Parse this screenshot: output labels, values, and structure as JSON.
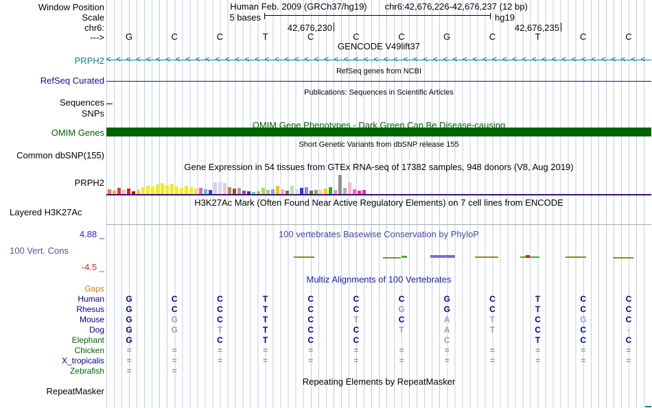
{
  "colors": {
    "gencode_teal": "#0d7d92",
    "refseq_blue": "#10108c",
    "omim_green": "#006400",
    "gtex_baseline": "#3c0a78",
    "phylop_title": "#4646aa",
    "phylop_max": "#2828cc",
    "phylop_min": "#c03030",
    "phylop_label": "#55509b",
    "multiz_title": "#1a1aae",
    "species_blue": "#00008b",
    "species_green": "#006400",
    "gaps_orange": "#c8820a",
    "grid_line": "#bfcdec",
    "h3k27ac_base": "#a6a6a6"
  },
  "header": {
    "window_position_label": "Window Position",
    "assembly": "Human Feb. 2009 (GRCh37/hg19)",
    "range": "chr6:42,676,226-42,676,237 (12 bp)",
    "scale_label": "Scale",
    "scale_text": "5 bases",
    "genome": "hg19",
    "chrom": "chr6:",
    "tick_left": "42,676,230",
    "tick_right": "42,676,235",
    "strand": "--->"
  },
  "sequence": [
    "G",
    "C",
    "C",
    "T",
    "C",
    "C",
    "C",
    "G",
    "C",
    "T",
    "C",
    "C"
  ],
  "gencode": {
    "title": "GENCODE V49lift37",
    "gene": "PRPH2",
    "arrow": "<"
  },
  "refseq": {
    "title": "RefSeq genes from NCBI",
    "label": "RefSeq Curated"
  },
  "publications": {
    "title": "Publications: Sequences in Scientific Articles",
    "label": "Sequences"
  },
  "snps_label": "SNPs",
  "omim": {
    "title": "OMIM Gene Phenotypes - Dark Green Can Be Disease-causing",
    "label": "OMIM Genes"
  },
  "dbsnp": {
    "title": "Short Genetic Variants from dbSNP release 155",
    "label": "Common dbSNP(155)"
  },
  "gtex": {
    "title": "Gene Expression in 54 tissues from GTEx RNA-seq of 17382 samples, 948 donors (V8, Aug 2019)",
    "label": "PRPH2",
    "bars": [
      [
        7,
        "#ff7733"
      ],
      [
        5,
        "#ffaa55"
      ],
      [
        9,
        "#ee3333"
      ],
      [
        6,
        "#ffbbaa"
      ],
      [
        8,
        "#cc2222"
      ],
      [
        4,
        "#991111"
      ],
      [
        6,
        "#eecc44"
      ],
      [
        10,
        "#eeee22"
      ],
      [
        12,
        "#eeee22"
      ],
      [
        11,
        "#eeee22"
      ],
      [
        14,
        "#eeee22"
      ],
      [
        16,
        "#eeee22"
      ],
      [
        13,
        "#eeee22"
      ],
      [
        15,
        "#eeee22"
      ],
      [
        11,
        "#eeee22"
      ],
      [
        9,
        "#eeee22"
      ],
      [
        12,
        "#eeee22"
      ],
      [
        10,
        "#eeee22"
      ],
      [
        8,
        "#eeee22"
      ],
      [
        9,
        "#ff55cc"
      ],
      [
        7,
        "#44cccc"
      ],
      [
        6,
        "#3344ee"
      ],
      [
        17,
        "#e0c8ee"
      ],
      [
        18,
        "#d8d8e8"
      ],
      [
        16,
        "#f0c8d8"
      ],
      [
        10,
        "#bb8855"
      ],
      [
        8,
        "#885533"
      ],
      [
        9,
        "#cc9977"
      ],
      [
        5,
        "#8844cc"
      ],
      [
        4,
        "#662299"
      ],
      [
        3,
        "#33ddcc"
      ],
      [
        4,
        "#aabb66"
      ],
      [
        9,
        "#99ee22"
      ],
      [
        6,
        "#a8c898"
      ],
      [
        7,
        "#9a9aee"
      ],
      [
        12,
        "#eec800"
      ],
      [
        7,
        "#ffaadd"
      ],
      [
        5,
        "#996633"
      ],
      [
        12,
        "#aaeea0"
      ],
      [
        7,
        "#dddddd"
      ],
      [
        9,
        "#3333ee"
      ],
      [
        10,
        "#8888ff"
      ],
      [
        5,
        "#667722"
      ],
      [
        6,
        "#88aa66"
      ],
      [
        6,
        "#ffdd88"
      ],
      [
        8,
        "#ffcc00"
      ],
      [
        10,
        "#22aa44"
      ],
      [
        6,
        "#ff88cc"
      ],
      [
        28,
        "#909090"
      ],
      [
        9,
        "#b0b0b0"
      ],
      [
        17,
        "#ffb6c8"
      ],
      [
        7,
        "#ff66bb"
      ],
      [
        5,
        "#ff22aa"
      ],
      [
        6,
        "#cc4488"
      ]
    ]
  },
  "h3k27ac": {
    "title": "H3K27Ac Mark (Often Found Near Active Regulatory Elements) on 7 cell lines from ENCODE",
    "label": "Layered H3K27Ac"
  },
  "phylop": {
    "title": "100 vertebrates Basewise Conservation by PhyloP",
    "label": "100 Vert. Cons",
    "max": "4.88 _",
    "min": "-4.5 _",
    "marks": [
      [
        428,
        374,
        30,
        2,
        "#8b8b1a"
      ],
      [
        558,
        375,
        26,
        2,
        "#8b8b1a"
      ],
      [
        585,
        373,
        8,
        3,
        "#44aa22"
      ],
      [
        627,
        372,
        36,
        4,
        "#7a6ad8"
      ],
      [
        692,
        374,
        34,
        2,
        "#8b8b1a"
      ],
      [
        758,
        374,
        28,
        2,
        "#44aa22"
      ],
      [
        766,
        372,
        6,
        4,
        "#cc2222"
      ],
      [
        824,
        374,
        30,
        2,
        "#8b8b1a"
      ],
      [
        893,
        375,
        30,
        2,
        "#8b8b1a"
      ]
    ]
  },
  "multiz": {
    "title": "Multiz Alignments of 100 Vertebrates",
    "rows": [
      {
        "name": "Gaps",
        "color": "#c8820a",
        "cells": []
      },
      {
        "name": "Human",
        "color": "#00008b",
        "cells": [
          [
            "G",
            "b"
          ],
          [
            "C",
            "b"
          ],
          [
            "C",
            "b"
          ],
          [
            "T",
            "b"
          ],
          [
            "C",
            "b"
          ],
          [
            "C",
            "b"
          ],
          [
            "C",
            "b"
          ],
          [
            "G",
            "b"
          ],
          [
            "C",
            "b"
          ],
          [
            "T",
            "b"
          ],
          [
            "C",
            "b"
          ],
          [
            "C",
            "b"
          ]
        ]
      },
      {
        "name": "Rhesus",
        "color": "#00008b",
        "cells": [
          [
            "G",
            "b"
          ],
          [
            "C",
            "b"
          ],
          [
            "C",
            "b"
          ],
          [
            "T",
            "b"
          ],
          [
            "C",
            "b"
          ],
          [
            "C",
            "b"
          ],
          [
            "G",
            "g"
          ],
          [
            "G",
            "b"
          ],
          [
            "C",
            "b"
          ],
          [
            "T",
            "b"
          ],
          [
            "C",
            "b"
          ],
          [
            "C",
            "b"
          ]
        ]
      },
      {
        "name": "Mouse",
        "color": "#00008b",
        "cells": [
          [
            "G",
            "b"
          ],
          [
            "G",
            "g"
          ],
          [
            "C",
            "b"
          ],
          [
            "T",
            "b"
          ],
          [
            "C",
            "b"
          ],
          [
            "T",
            "g"
          ],
          [
            "C",
            "b"
          ],
          [
            "A",
            "g"
          ],
          [
            "T",
            "g"
          ],
          [
            "C",
            "b"
          ],
          [
            "G",
            "g"
          ],
          [
            "C",
            "b"
          ]
        ]
      },
      {
        "name": "Dog",
        "color": "#00008b",
        "cells": [
          [
            "G",
            "b"
          ],
          [
            "G",
            "g"
          ],
          [
            "T",
            "g"
          ],
          [
            "T",
            "b"
          ],
          [
            "C",
            "b"
          ],
          [
            "C",
            "b"
          ],
          [
            "T",
            "g"
          ],
          [
            "A",
            "g"
          ],
          [
            "T",
            "g"
          ],
          [
            "C",
            "b"
          ],
          [
            "C",
            "b"
          ],
          [
            "-",
            "g"
          ]
        ]
      },
      {
        "name": "Elephant",
        "color": "#006400",
        "cells": [
          [
            "G",
            "b"
          ],
          [
            "",
            "b"
          ],
          [
            "C",
            "b"
          ],
          [
            "T",
            "b"
          ],
          [
            "C",
            "b"
          ],
          [
            "C",
            "b"
          ],
          [
            "",
            "b"
          ],
          [
            "C",
            "g"
          ],
          [
            "",
            "b"
          ],
          [
            "T",
            "b"
          ],
          [
            "C",
            "b"
          ],
          [
            "C",
            "b"
          ]
        ]
      },
      {
        "name": "Chicken",
        "color": "#006400",
        "cells": [
          [
            "=",
            "q"
          ],
          [
            "=",
            "q"
          ],
          [
            "=",
            "q"
          ],
          [
            "=",
            "q"
          ],
          [
            "=",
            "q"
          ],
          [
            "=",
            "q"
          ],
          [
            "=",
            "q"
          ],
          [
            "=",
            "q"
          ],
          [
            "=",
            "q"
          ],
          [
            "=",
            "q"
          ],
          [
            "=",
            "q"
          ],
          [
            "=",
            "q"
          ]
        ]
      },
      {
        "name": "X_tropicalis",
        "color": "#00008b",
        "cells": [
          [
            "=",
            "q"
          ],
          [
            "=",
            "q"
          ],
          [
            "=",
            "q"
          ],
          [
            "=",
            "q"
          ],
          [
            "=",
            "q"
          ],
          [
            "=",
            "q"
          ],
          [
            "=",
            "q"
          ],
          [
            "=",
            "q"
          ],
          [
            "=",
            "q"
          ],
          [
            "=",
            "q"
          ],
          [
            "=",
            "q"
          ],
          [
            "=",
            "q"
          ]
        ]
      },
      {
        "name": "Zebrafish",
        "color": "#006400",
        "cells": [
          [
            "=",
            "q"
          ],
          [
            "=",
            "q"
          ],
          [
            "",
            ""
          ],
          [
            "",
            ""
          ],
          [
            "",
            ""
          ],
          [
            "",
            ""
          ],
          [
            "",
            ""
          ],
          [
            "",
            ""
          ],
          [
            "",
            ""
          ],
          [
            "",
            ""
          ],
          [
            "",
            ""
          ],
          [
            "",
            ""
          ]
        ]
      }
    ]
  },
  "repeatmasker": {
    "title": "Repeating Elements by RepeatMasker",
    "label": "RepeatMasker"
  }
}
